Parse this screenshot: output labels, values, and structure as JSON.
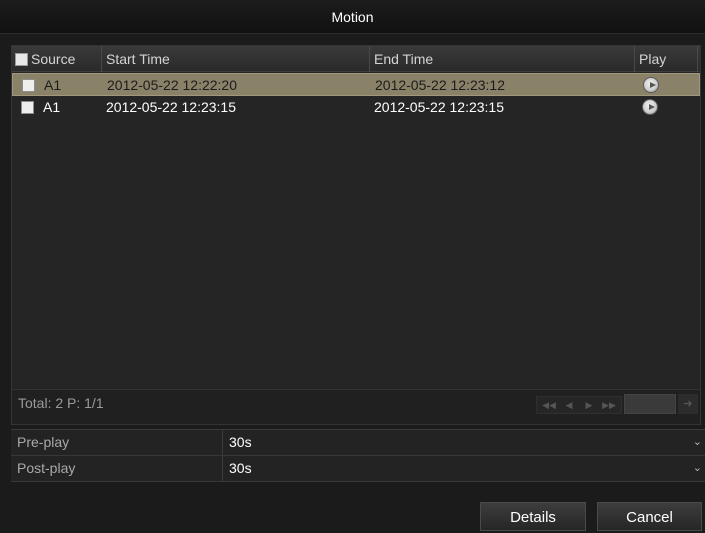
{
  "window": {
    "title": "Motion"
  },
  "table": {
    "columns": {
      "source": "Source",
      "start_time": "Start Time",
      "end_time": "End Time",
      "play": "Play"
    },
    "rows": [
      {
        "source": "A1",
        "start_time": "2012-05-22 12:22:20",
        "end_time": "2012-05-22 12:23:12",
        "selected": true,
        "play_icon": "play-circle-icon"
      },
      {
        "source": "A1",
        "start_time": "2012-05-22 12:23:15",
        "end_time": "2012-05-22 12:23:15",
        "selected": false,
        "play_icon": "play-circle-icon"
      }
    ]
  },
  "footer": {
    "total_text": "Total: 2  P: 1/1",
    "pager_icons": [
      "first-page-icon",
      "prev-page-icon",
      "next-page-icon",
      "last-page-icon",
      "go-icon"
    ]
  },
  "settings": {
    "pre_play": {
      "label": "Pre-play",
      "value": "30s"
    },
    "post_play": {
      "label": "Post-play",
      "value": "30s"
    }
  },
  "buttons": {
    "details": "Details",
    "cancel": "Cancel"
  },
  "colors": {
    "selected_row": "#8a8169",
    "background": "#1b1b1b",
    "panel": "#252525"
  }
}
